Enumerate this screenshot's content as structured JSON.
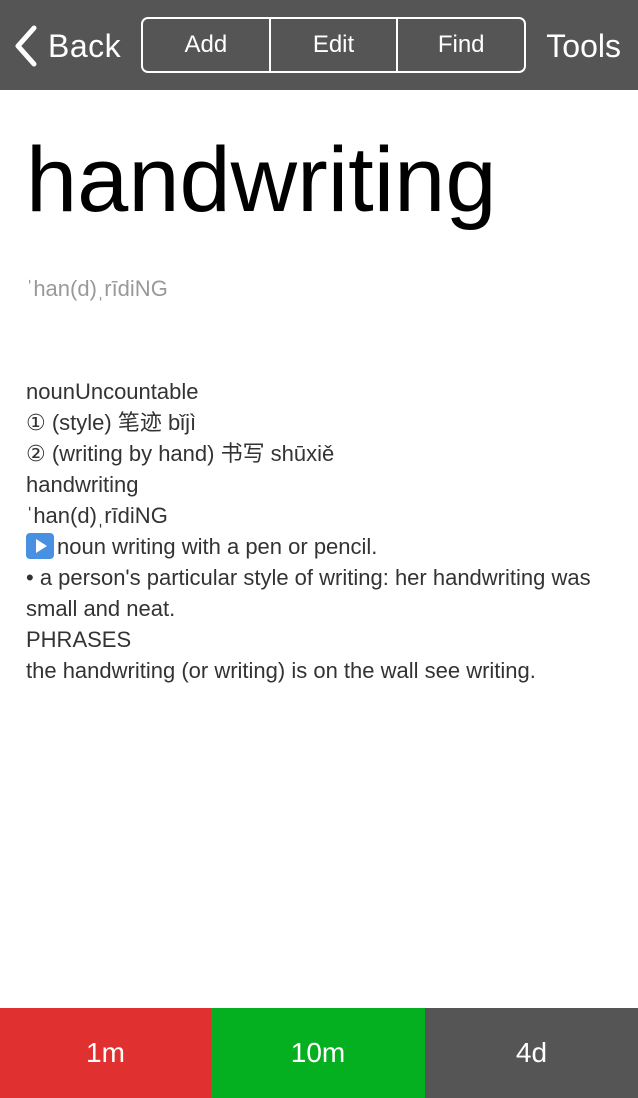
{
  "nav": {
    "back_label": "Back",
    "segments": [
      "Add",
      "Edit",
      "Find"
    ],
    "tools_label": "Tools"
  },
  "entry": {
    "headword": "handwriting",
    "pronunciation": "ˈhan(d)ˌrīdiNG",
    "lines": [
      "nounUncountable",
      "① (style) 笔迹 bǐjì",
      "② (writing by hand) 书写 shūxiě",
      "handwriting",
      "ˈhan(d)ˌrīdiNG",
      "noun writing with a pen or pencil.",
      "• a person's particular style of writing: her handwriting was small and neat.",
      "PHRASES",
      "the handwriting (or writing) is on the wall see writing."
    ]
  },
  "review": {
    "buttons": [
      {
        "label": "1m",
        "color": "#e03030"
      },
      {
        "label": "10m",
        "color": "#04b020"
      },
      {
        "label": "4d",
        "color": "#555555"
      }
    ]
  },
  "colors": {
    "topbar": "#555555",
    "headword": "#000000",
    "pron": "#999999"
  }
}
